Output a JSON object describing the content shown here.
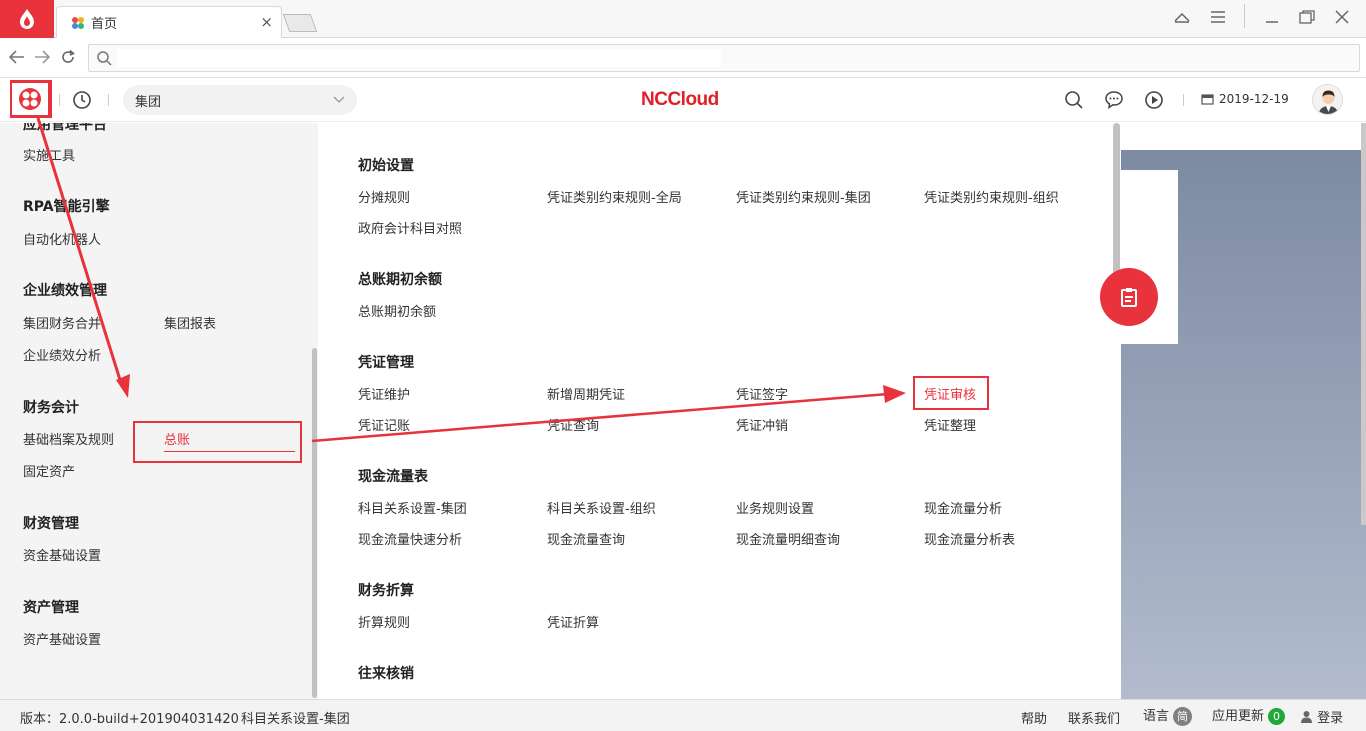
{
  "browser": {
    "tab_title": "首页",
    "tab_close": "×",
    "url_value": "",
    "window_controls": [
      "skin-icon",
      "menu-icon",
      "minimize-icon",
      "maximize-icon",
      "close-icon"
    ]
  },
  "header": {
    "group_select_value": "集团",
    "brand": "NCCloud",
    "date": "2019-12-19",
    "icons": [
      "search-icon",
      "message-icon",
      "play-icon",
      "calendar-icon"
    ]
  },
  "left_panel": {
    "categories": [
      {
        "title": "应用管理平台",
        "items": [
          "实施工具"
        ]
      },
      {
        "title": "RPA智能引擎",
        "items": [
          "自动化机器人"
        ]
      },
      {
        "title": "企业绩效管理",
        "items": [
          "集团财务合并",
          "集团报表",
          "企业绩效分析"
        ]
      },
      {
        "title": "财务会计",
        "items": [
          "基础档案及规则",
          "总账",
          "固定资产"
        ]
      },
      {
        "title": "财资管理",
        "items": [
          "资金基础设置"
        ]
      },
      {
        "title": "资产管理",
        "items": [
          "资产基础设置"
        ]
      }
    ],
    "active_item": "总账"
  },
  "menu_panel": {
    "sections": [
      {
        "title": "初始设置",
        "items": [
          "分摊规则",
          "凭证类别约束规则-全局",
          "凭证类别约束规则-集团",
          "凭证类别约束规则-组织",
          "政府会计科目对照"
        ]
      },
      {
        "title": "总账期初余额",
        "items": [
          "总账期初余额"
        ]
      },
      {
        "title": "凭证管理",
        "items": [
          "凭证维护",
          "新增周期凭证",
          "凭证签字",
          "凭证审核",
          "凭证记账",
          "凭证查询",
          "凭证冲销",
          "凭证整理"
        ]
      },
      {
        "title": "现金流量表",
        "items": [
          "科目关系设置-集团",
          "科目关系设置-组织",
          "业务规则设置",
          "现金流量分析",
          "现金流量快速分析",
          "现金流量查询",
          "现金流量明细查询",
          "现金流量分析表"
        ]
      },
      {
        "title": "财务折算",
        "items": [
          "折算规则",
          "凭证折算"
        ]
      },
      {
        "title": "往来核销",
        "items": []
      }
    ],
    "highlighted_item": "凭证审核"
  },
  "status_bar": {
    "version": "版本：2.0.0-build+201904031420",
    "current_node": "科目关系设置-集团",
    "help": "帮助",
    "contact": "联系我们",
    "language_label": "语言",
    "language_badge": "简",
    "update_label": "应用更新",
    "update_count": "0",
    "login": "登录"
  },
  "colors": {
    "accent": "#e8323c",
    "left_panel_bg": "#f4f4f4",
    "update_badge": "#21a838"
  }
}
